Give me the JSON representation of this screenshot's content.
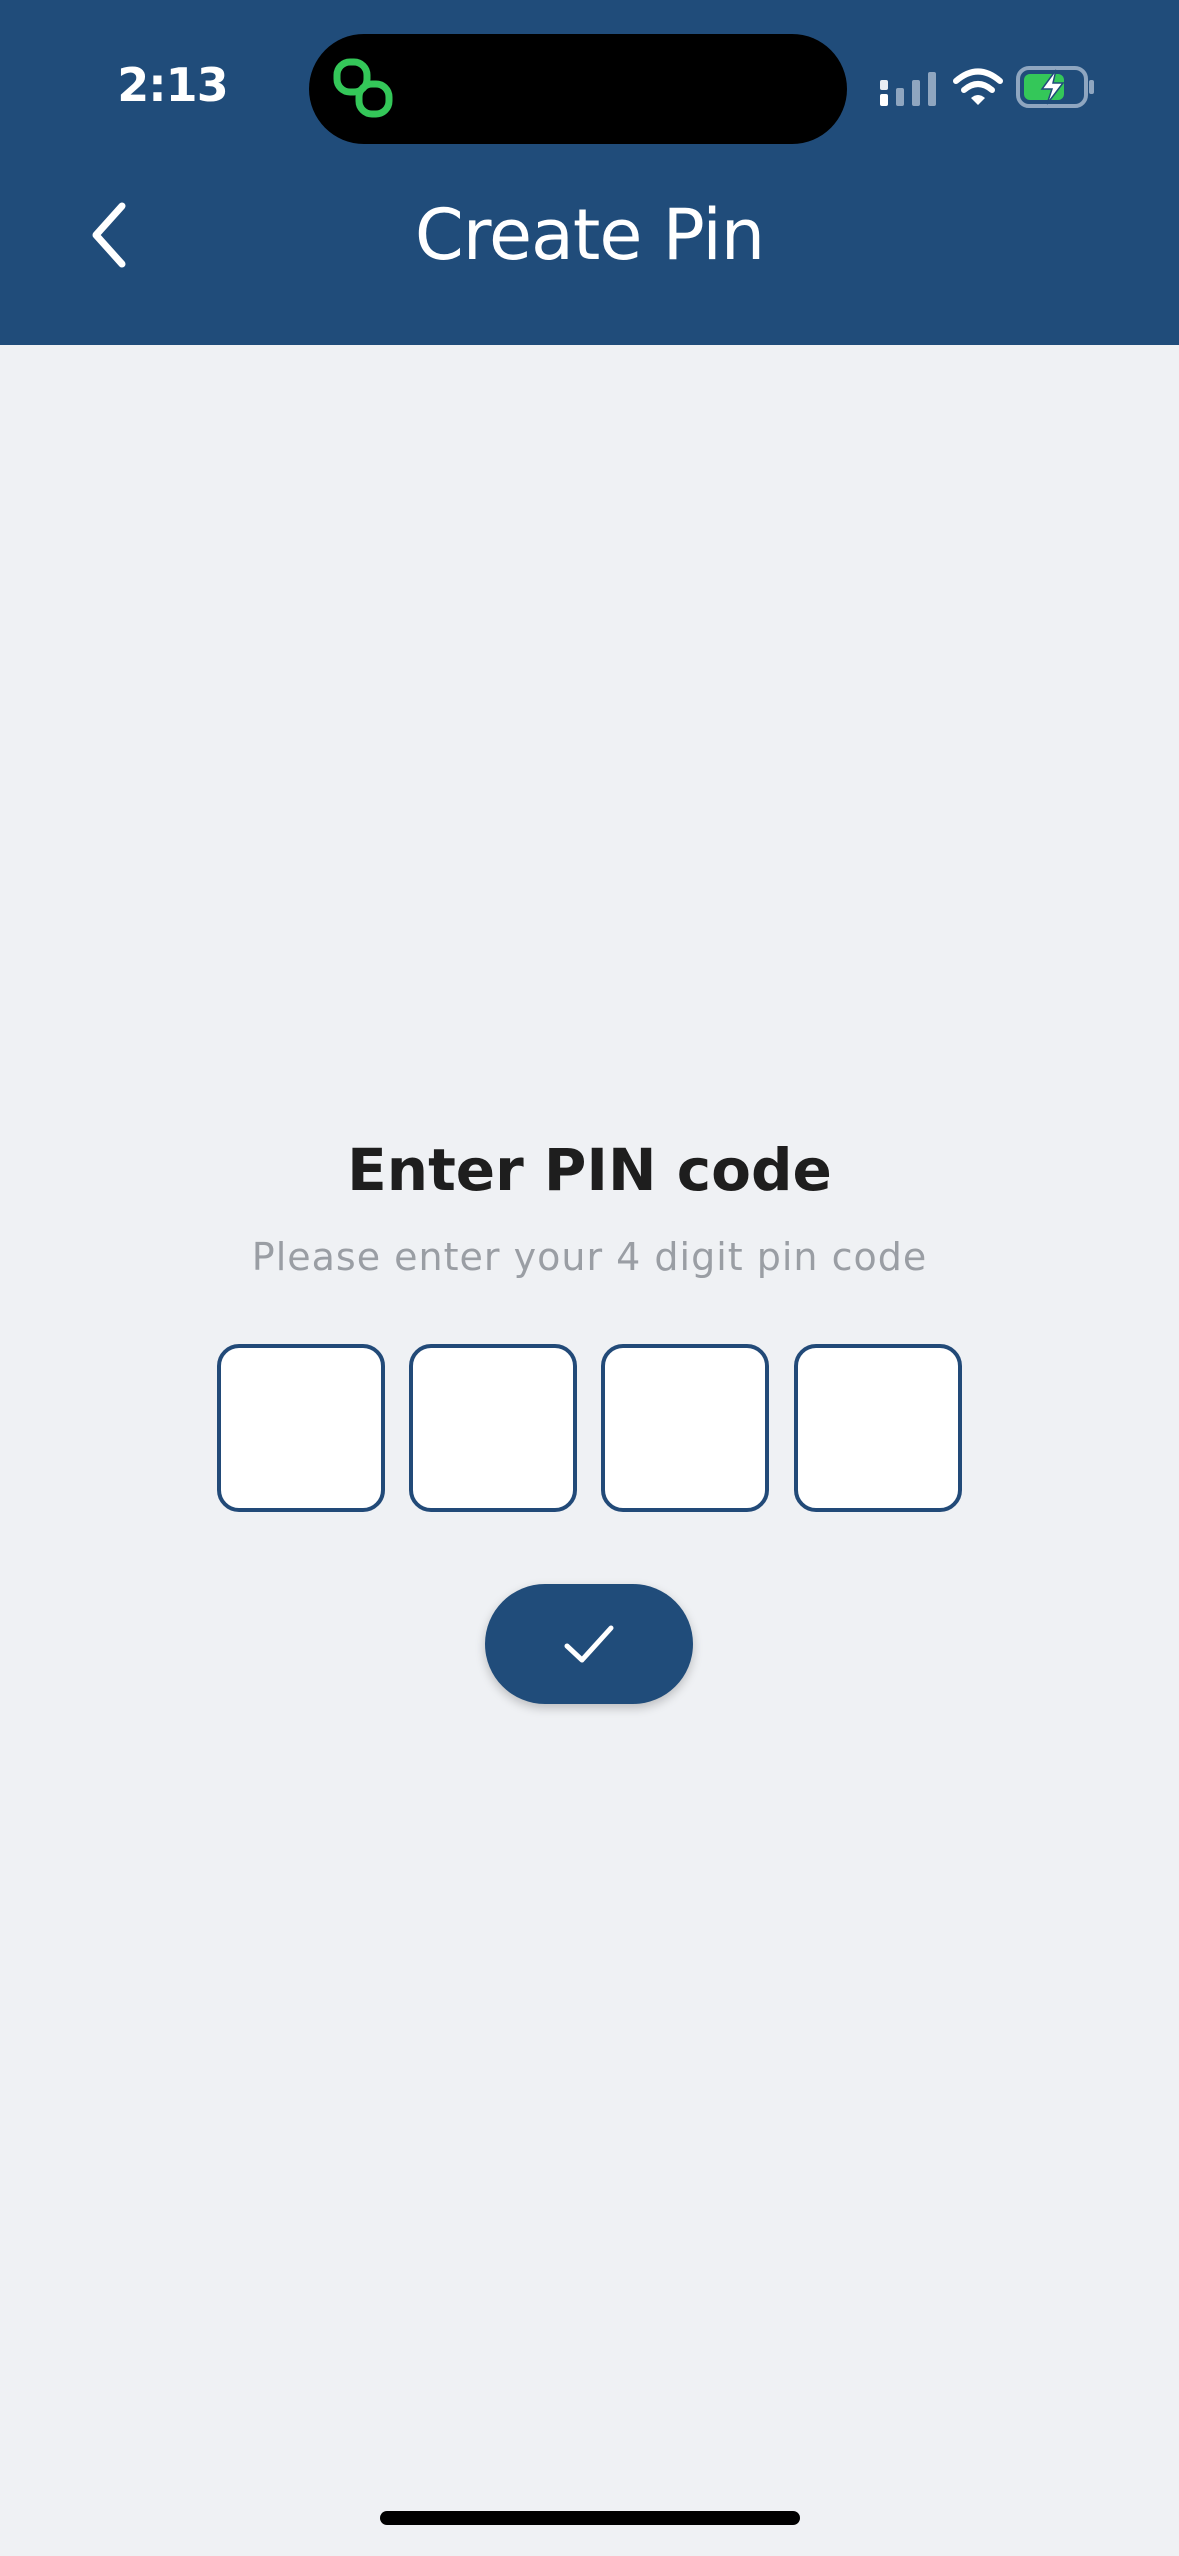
{
  "status_bar": {
    "time": "2:13",
    "island_app_icon": "link-chain-icon",
    "signal_icon": "cellular-signal-icon",
    "wifi_icon": "wifi-icon",
    "battery_icon": "battery-charging-icon"
  },
  "header": {
    "back_icon": "chevron-left-icon",
    "title": "Create Pin"
  },
  "pin_entry": {
    "heading": "Enter PIN code",
    "subtitle": "Please enter your 4 digit pin code",
    "digits": [
      "",
      "",
      "",
      ""
    ],
    "confirm_icon": "checkmark-icon"
  },
  "colors": {
    "header_bg": "#204c7a",
    "page_bg": "#eff1f4",
    "box_border": "#224a78",
    "accent_green": "#34c759"
  }
}
